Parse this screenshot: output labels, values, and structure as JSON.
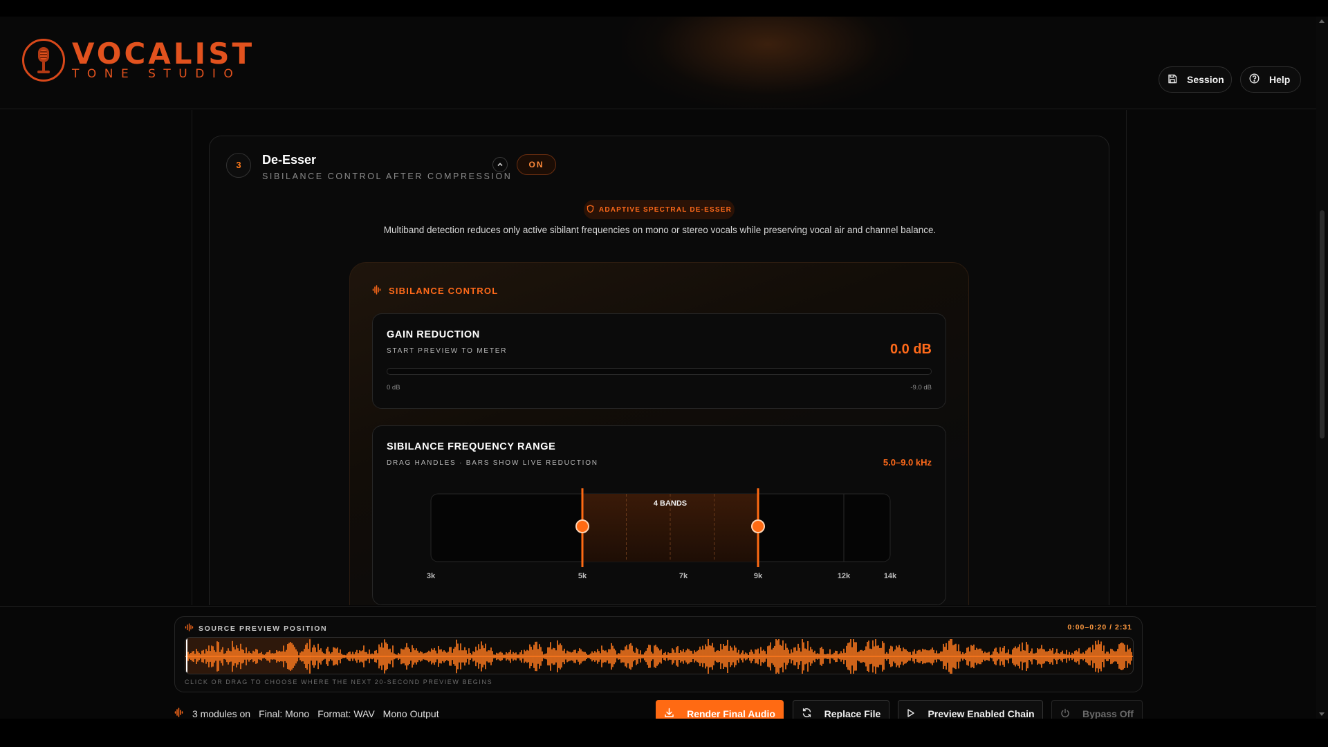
{
  "app": {
    "logo_title": "VOCALIST",
    "logo_subtitle": "TONE STUDIO"
  },
  "header": {
    "session_label": "Session",
    "help_label": "Help"
  },
  "module": {
    "number": "3",
    "title": "De-Esser",
    "subtitle": "SIBILANCE CONTROL AFTER COMPRESSION",
    "toggle_label": "ON",
    "badge": "ADAPTIVE SPECTRAL DE-ESSER",
    "description": "Multiband detection reduces only active sibilant frequencies on mono or stereo vocals while preserving vocal air and channel balance."
  },
  "sibilance_card": {
    "title": "SIBILANCE CONTROL",
    "gain_reduction": {
      "title": "GAIN REDUCTION",
      "subtitle": "START PREVIEW TO METER",
      "value": "0.0 dB",
      "meter_min": "0 dB",
      "meter_max": "-9.0 dB",
      "level_fraction": 0.0
    },
    "frequency_range": {
      "title": "SIBILANCE FREQUENCY RANGE",
      "subtitle": "DRAG HANDLES · BARS SHOW LIVE REDUCTION",
      "value": "5.0–9.0 kHz",
      "bands_label": "4 BANDS",
      "band_count": 4,
      "ticks": [
        "3k",
        "5k",
        "7k",
        "9k",
        "12k",
        "14k"
      ],
      "tick_hz": [
        3000,
        5000,
        7000,
        9000,
        12000,
        14000
      ],
      "low_hz": 5000,
      "high_hz": 9000
    }
  },
  "dock": {
    "waveform_label": "SOURCE PREVIEW POSITION",
    "time_label": "0:00–0:20 / 2:31",
    "preview_start_s": 0,
    "preview_end_s": 20,
    "duration_s": 151,
    "hint": "CLICK OR DRAG TO CHOOSE WHERE THE NEXT 20-SECOND PREVIEW BEGINS",
    "status": {
      "modules": "3 modules on",
      "final": "Final: Mono",
      "format": "Format: WAV",
      "output": "Mono Output"
    },
    "buttons": {
      "render": "Render Final Audio",
      "replace": "Replace File",
      "preview": "Preview Enabled Chain",
      "bypass": "Bypass Off"
    }
  },
  "colors": {
    "accent": "#ff6a13",
    "accent_text": "#ff6a1a",
    "background": "#070707"
  },
  "icons": {
    "logo": "microphone-icon",
    "session": "save-icon",
    "help": "help-circle-icon",
    "collapse": "chevron-up-icon",
    "badge": "shield-icon",
    "sibilance": "waveform-icon",
    "render": "download-icon",
    "replace": "refresh-icon",
    "preview": "play-icon",
    "bypass": "power-icon"
  }
}
